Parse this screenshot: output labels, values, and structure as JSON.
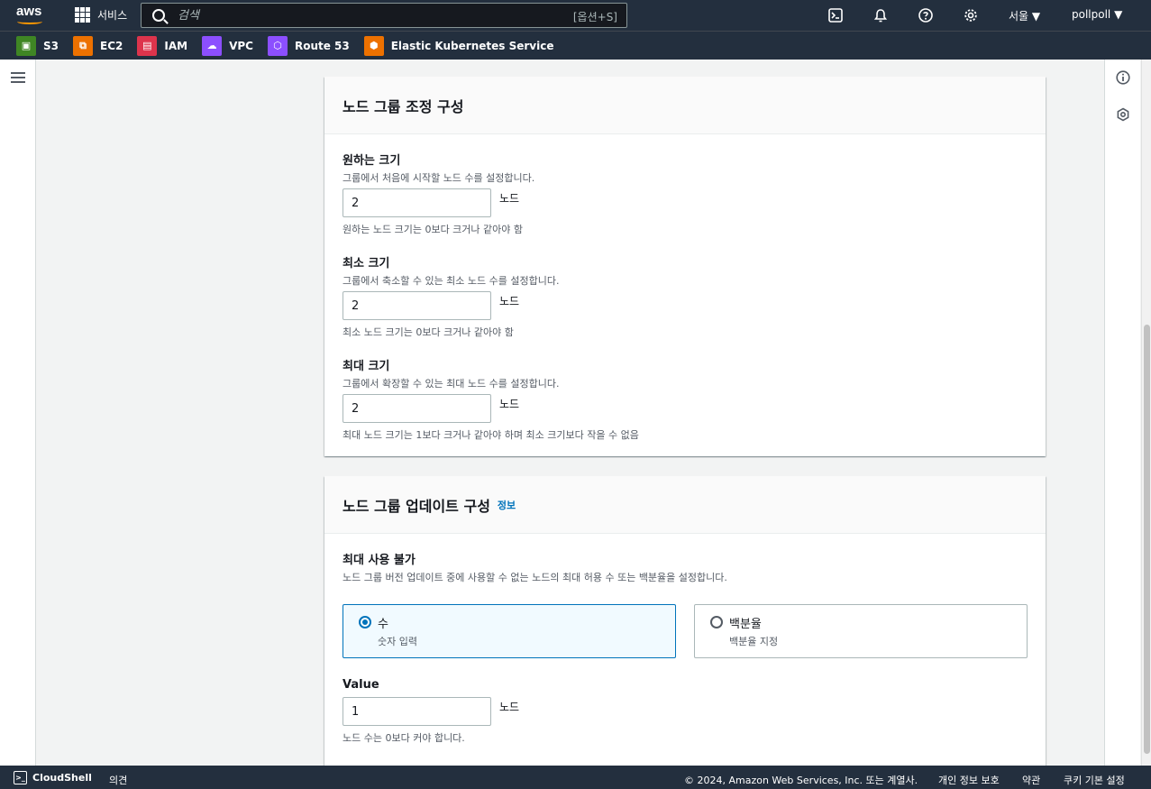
{
  "topnav": {
    "logo_text": "aws",
    "services_label": "서비스",
    "search_placeholder": "검색",
    "search_shortcut": "[옵션+S]",
    "region": "서울 ▼",
    "account": "pollpoll ▼"
  },
  "favorites": [
    {
      "label": "S3",
      "color": "#3f8624",
      "icon": "s3-icon"
    },
    {
      "label": "EC2",
      "color": "#ed7100",
      "icon": "ec2-icon"
    },
    {
      "label": "IAM",
      "color": "#dd344c",
      "icon": "iam-icon"
    },
    {
      "label": "VPC",
      "color": "#8c4fff",
      "icon": "vpc-icon"
    },
    {
      "label": "Route 53",
      "color": "#8c4fff",
      "icon": "route53-icon"
    },
    {
      "label": "Elastic Kubernetes Service",
      "color": "#ed7100",
      "icon": "eks-icon"
    }
  ],
  "scaling": {
    "title": "노드 그룹 조정 구성",
    "desired": {
      "label": "원하는 크기",
      "description": "그룹에서 처음에 시작할 노드 수를 설정합니다.",
      "value": "2",
      "unit": "노드",
      "constraint": "원하는 노드 크기는 0보다 크거나 같아야 함"
    },
    "minimum": {
      "label": "최소 크기",
      "description": "그룹에서 축소할 수 있는 최소 노드 수를 설정합니다.",
      "value": "2",
      "unit": "노드",
      "constraint": "최소 노드 크기는 0보다 크거나 같아야 함"
    },
    "maximum": {
      "label": "최대 크기",
      "description": "그룹에서 확장할 수 있는 최대 노드 수를 설정합니다.",
      "value": "2",
      "unit": "노드",
      "constraint": "최대 노드 크기는 1보다 크거나 같아야 하며 최소 크기보다 작을 수 없음"
    }
  },
  "update": {
    "title": "노드 그룹 업데이트 구성",
    "info_link": "정보",
    "max_unavailable": {
      "label": "최대 사용 불가",
      "description": "노드 그룹 버전 업데이트 중에 사용할 수 없는 노드의 최대 허용 수 또는 백분율을 설정합니다."
    },
    "options": [
      {
        "label": "수",
        "description": "숫자 입력",
        "selected": true
      },
      {
        "label": "백분율",
        "description": "백분율 지정",
        "selected": false
      }
    ],
    "value_field": {
      "label": "Value",
      "value": "1",
      "unit": "노드",
      "constraint": "노드 수는 0보다 커야 합니다."
    }
  },
  "footer": {
    "cloudshell": "CloudShell",
    "feedback": "의견",
    "copyright": "© 2024, Amazon Web Services, Inc. 또는 계열사.",
    "privacy": "개인 정보 보호",
    "terms": "약관",
    "cookies": "쿠키 기본 설정"
  }
}
